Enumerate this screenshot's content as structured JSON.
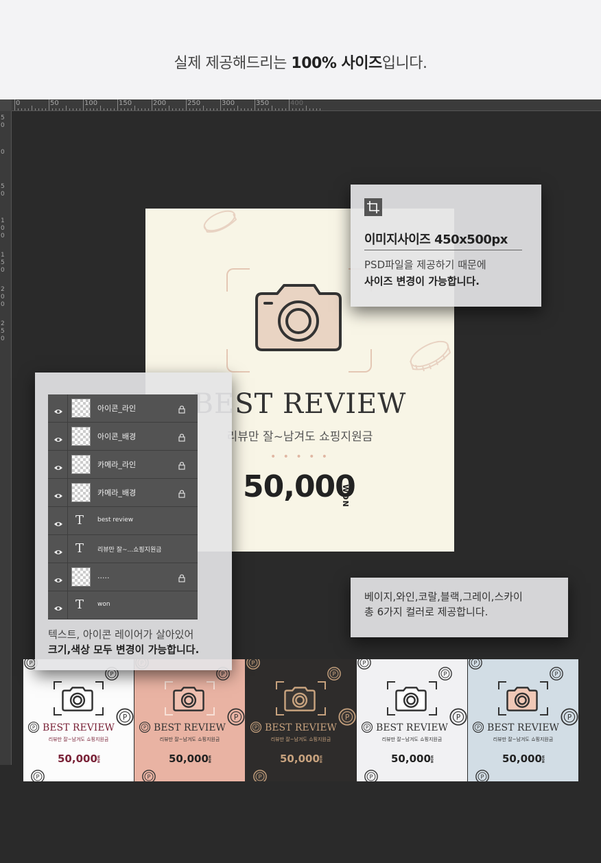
{
  "header": {
    "headline_prefix": "실제 제공해드리는 ",
    "headline_bold": "100% 사이즈",
    "headline_suffix": "입니다."
  },
  "ruler": {
    "top_labels": [
      "0",
      "50",
      "100",
      "150",
      "200",
      "250",
      "300",
      "350",
      "400"
    ],
    "left_labels": [
      "5\n0",
      "0",
      "5\n0",
      "1\n0\n0",
      "1\n5\n0",
      "2\n0\n0",
      "2\n5\n0"
    ]
  },
  "card": {
    "title": "BEST REVIEW",
    "subtitle": "리뷰만 잘~남겨도 쇼핑지원금",
    "dots": "• • • • •",
    "amount": "50,000",
    "unit": "WON"
  },
  "size_info": {
    "title": "이미지사이즈 450x500px",
    "line1": "PSD파일을 제공하기 때문에",
    "line2": "사이즈 변경이 가능합니다."
  },
  "color_info": {
    "line1": "베이지,와인,코랄,블랙,그레이,스카이",
    "line2": "총 6가지 컬러로 제공합니다."
  },
  "layers": {
    "rows": [
      {
        "name": "아이콘_라인",
        "kind": "image",
        "locked": true
      },
      {
        "name": "아이콘_배경",
        "kind": "image",
        "locked": true
      },
      {
        "name": "카메라_라인",
        "kind": "image",
        "locked": true
      },
      {
        "name": "카메라_배경",
        "kind": "image",
        "locked": true
      },
      {
        "name": "best review",
        "kind": "text",
        "locked": false
      },
      {
        "name": "리뷰만 잘~...쇼핑지원금",
        "kind": "text",
        "locked": false
      },
      {
        "name": ".....",
        "kind": "image",
        "locked": true
      },
      {
        "name": "won",
        "kind": "text",
        "locked": false
      }
    ],
    "desc1": "텍스트, 아이콘 레이어가 살아있어",
    "desc2": "크기,색상 모두 변경이 가능합니다."
  },
  "variants": [
    {
      "name": "wine",
      "bg": "#fcfcfc",
      "accent": "#7a2338",
      "text": "#7a2338",
      "amount_color": "#7a2338",
      "cam_fill": "#ffffff",
      "cam_line": "#333333",
      "corner": "#333333",
      "title": "BEST REVIEW",
      "subtitle": "리뷰만 잘~남겨도 쇼핑지원금",
      "amount": "50,000",
      "unit": "WON"
    },
    {
      "name": "coral",
      "bg": "#e9b3a3",
      "accent": "#333333",
      "text": "#333333",
      "amount_color": "#222222",
      "cam_fill": "#f0c1b1",
      "cam_line": "#333333",
      "corner": "#f8e0d6",
      "title": "BEST REVIEW",
      "subtitle": "리뷰만 잘~남겨도 쇼핑지원금",
      "amount": "50,000",
      "unit": "WON"
    },
    {
      "name": "black",
      "bg": "#2e2c2b",
      "accent": "#c7a27e",
      "text": "#c7a27e",
      "amount_color": "#c7a27e",
      "cam_fill": "#3a3633",
      "cam_line": "#c7a27e",
      "corner": "#c7a27e",
      "title": "BEST REVIEW",
      "subtitle": "리뷰만 잘~남겨도 쇼핑지원금",
      "amount": "50,000",
      "unit": "WON"
    },
    {
      "name": "gray",
      "bg": "#f1f1f3",
      "accent": "#333333",
      "text": "#333333",
      "amount_color": "#222222",
      "cam_fill": "#ffffff",
      "cam_line": "#333333",
      "corner": "#333333",
      "title": "BEST REVIEW",
      "subtitle": "리뷰만 잘~남겨도 쇼핑지원금",
      "amount": "50,000",
      "unit": "WON"
    },
    {
      "name": "sky",
      "bg": "#d2dde5",
      "accent": "#333333",
      "text": "#333333",
      "amount_color": "#222222",
      "cam_fill": "#f0c8b6",
      "cam_line": "#333333",
      "corner": "#333333",
      "title": "BEST REVIEW",
      "subtitle": "리뷰만 잘~남겨도 쇼핑지원금",
      "amount": "50,000",
      "unit": "WON"
    }
  ],
  "icons": {
    "eye": "eye-icon",
    "lock": "lock-icon",
    "crop": "crop-icon",
    "camera": "camera-icon",
    "coin": "coin-icon",
    "text_layer": "text-layer-icon"
  }
}
